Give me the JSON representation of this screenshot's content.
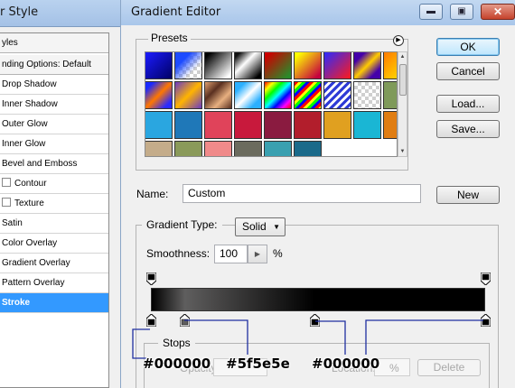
{
  "layer_style": {
    "title": "r Style",
    "header_rows": [
      "yles",
      "nding Options: Default"
    ],
    "effects": [
      {
        "label": "Drop Shadow",
        "checkbox": false
      },
      {
        "label": "Inner Shadow",
        "checkbox": false
      },
      {
        "label": "Outer Glow",
        "checkbox": false
      },
      {
        "label": "Inner Glow",
        "checkbox": false
      },
      {
        "label": "Bevel and Emboss",
        "checkbox": false
      },
      {
        "label": "Contour",
        "checkbox": true
      },
      {
        "label": "Texture",
        "checkbox": true
      },
      {
        "label": "Satin",
        "checkbox": false
      },
      {
        "label": "Color Overlay",
        "checkbox": false
      },
      {
        "label": "Gradient Overlay",
        "checkbox": false
      },
      {
        "label": "Pattern Overlay",
        "checkbox": false
      },
      {
        "label": "Stroke",
        "checkbox": false,
        "selected": true
      }
    ]
  },
  "gradient_editor": {
    "title": "Gradient Editor",
    "window_buttons": {
      "minimize": "▬",
      "maximize": "▣",
      "close": "✕"
    },
    "presets_label": "Presets",
    "buttons": {
      "ok": "OK",
      "cancel": "Cancel",
      "load": "Load...",
      "save": "Save...",
      "new": "New"
    },
    "name_label": "Name:",
    "name_value": "Custom",
    "gradient_type_label": "Gradient Type:",
    "gradient_type_value": "Solid",
    "smoothness_label": "Smoothness:",
    "smoothness_value": "100",
    "smoothness_unit": "%",
    "stops_label": "Stops",
    "stops_faded": {
      "opacity": "Opacity:",
      "location": "Location:",
      "percent": "%",
      "delete": "Delete"
    },
    "color_stops": [
      {
        "color": "#000000",
        "location_pct": 0
      },
      {
        "color": "#5f5e5e",
        "location_pct": 10
      },
      {
        "color": "#000000",
        "location_pct": 49
      },
      {
        "color": "#000000",
        "location_pct": 100
      }
    ],
    "opacity_stops_pct": [
      0,
      100
    ]
  },
  "annotations": [
    "#000000",
    "#5f5e5e",
    "#000000"
  ],
  "colors": {
    "selected_row": "#3399ff",
    "window_bg": "#f0f0f0",
    "titlebar": "#a9c6ea",
    "close_button": "#c5422b"
  }
}
